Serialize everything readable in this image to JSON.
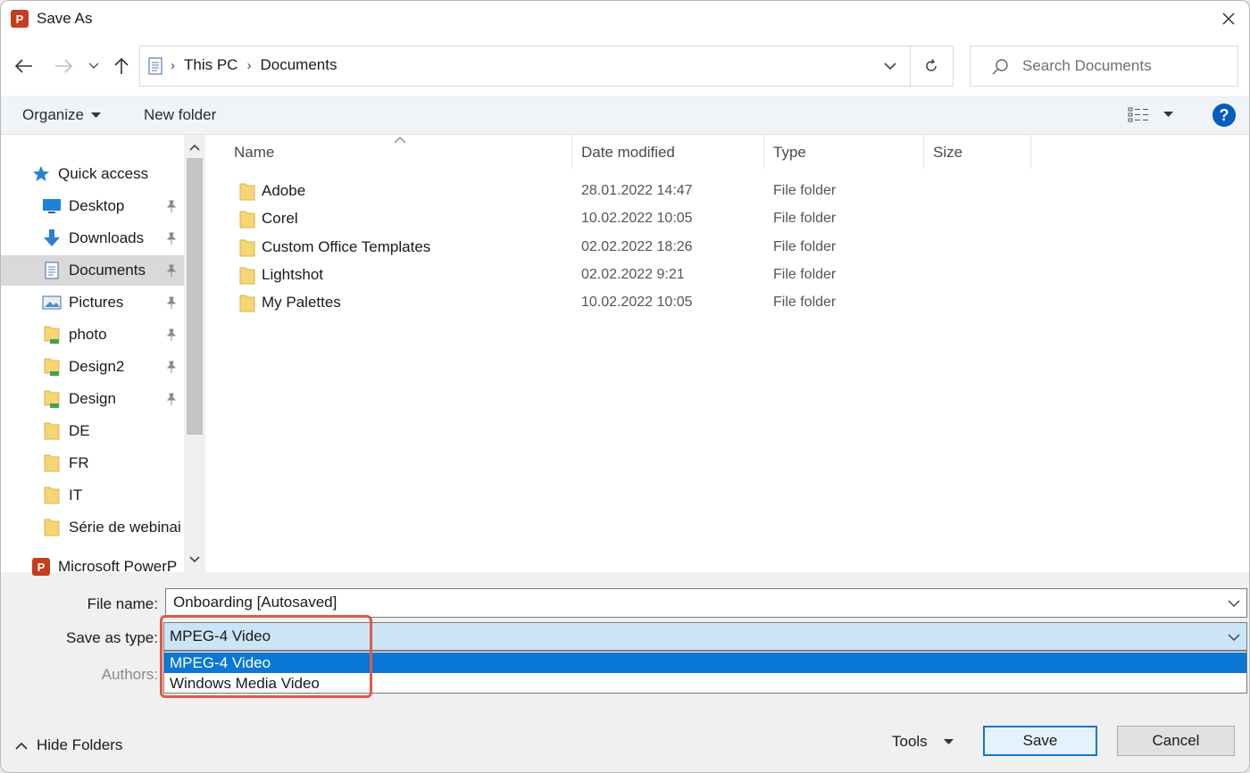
{
  "window": {
    "title": "Save As"
  },
  "address": {
    "crumbs": [
      "This PC",
      "Documents"
    ]
  },
  "search": {
    "placeholder": "Search Documents"
  },
  "toolbar": {
    "organize": "Organize",
    "new_folder": "New folder",
    "help": "?"
  },
  "nav": {
    "items": [
      {
        "label": "Quick access",
        "icon": "star-icon",
        "pinned": false
      },
      {
        "label": "Desktop",
        "icon": "desktop-icon",
        "pinned": true
      },
      {
        "label": "Downloads",
        "icon": "download-icon",
        "pinned": true
      },
      {
        "label": "Documents",
        "icon": "document-icon",
        "pinned": true,
        "selected": true
      },
      {
        "label": "Pictures",
        "icon": "pictures-icon",
        "pinned": true
      },
      {
        "label": "photo",
        "icon": "folder-shared-icon",
        "pinned": true
      },
      {
        "label": "Design2",
        "icon": "folder-shared-icon",
        "pinned": true
      },
      {
        "label": "Design",
        "icon": "folder-shared-icon",
        "pinned": true
      },
      {
        "label": "DE",
        "icon": "folder-icon",
        "pinned": false
      },
      {
        "label": "FR",
        "icon": "folder-icon",
        "pinned": false
      },
      {
        "label": "IT",
        "icon": "folder-icon",
        "pinned": false
      },
      {
        "label": "Série de webinai",
        "icon": "folder-icon",
        "pinned": false
      },
      {
        "label": "Microsoft PowerP",
        "icon": "powerpoint-icon",
        "pinned": false
      }
    ]
  },
  "columns": {
    "name": "Name",
    "date": "Date modified",
    "type": "Type",
    "size": "Size"
  },
  "files": [
    {
      "name": "Adobe",
      "date": "28.01.2022 14:47",
      "type": "File folder"
    },
    {
      "name": "Corel",
      "date": "10.02.2022 10:05",
      "type": "File folder"
    },
    {
      "name": "Custom Office Templates",
      "date": "02.02.2022 18:26",
      "type": "File folder"
    },
    {
      "name": "Lightshot",
      "date": "02.02.2022 9:21",
      "type": "File folder"
    },
    {
      "name": "My Palettes",
      "date": "10.02.2022 10:05",
      "type": "File folder"
    }
  ],
  "form": {
    "file_name_label": "File name:",
    "file_name_value": "Onboarding [Autosaved]",
    "save_type_label": "Save as type:",
    "save_type_value": "MPEG-4 Video",
    "type_options": [
      "MPEG-4 Video",
      "Windows Media Video"
    ],
    "authors_label": "Authors:"
  },
  "footer": {
    "hide_folders": "Hide Folders",
    "tools": "Tools",
    "save": "Save",
    "cancel": "Cancel"
  },
  "colors": {
    "accent": "#0a78d4",
    "highlight": "#e2584a",
    "folder": "#f6d573"
  }
}
